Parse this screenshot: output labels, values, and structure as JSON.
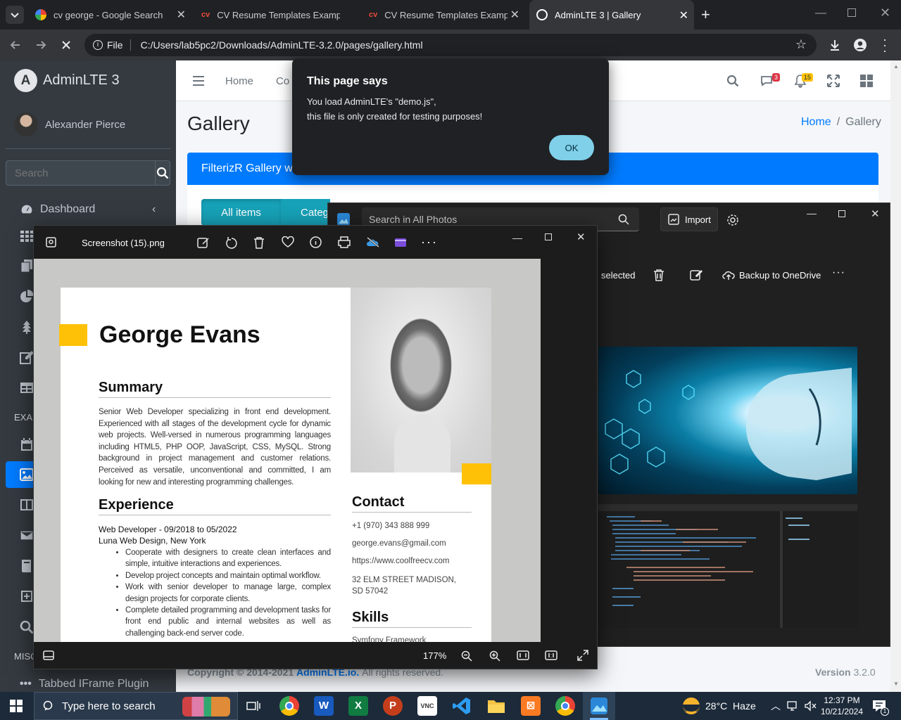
{
  "browser": {
    "tabs": [
      {
        "title": "cv george - Google Search",
        "icon": "google-icon"
      },
      {
        "title": "CV Resume Templates Examples",
        "icon": "cv-icon"
      },
      {
        "title": "CV Resume Templates Examples",
        "icon": "cv-icon"
      },
      {
        "title": "AdminLTE 3 | Gallery",
        "icon": "adminlte-icon",
        "active": true
      }
    ],
    "address_prefix": "File",
    "url": "C:/Users/lab5pc2/Downloads/AdminLTE-3.2.0/pages/gallery.html"
  },
  "sidebar": {
    "brand": "AdminLTE 3",
    "user": "Alexander Pierce",
    "search_placeholder": "Search",
    "dashboard": "Dashboard",
    "examples_header": "EXAM",
    "misc_header": "MISC",
    "bottom_item": "Tabbed IFrame Plugin"
  },
  "topnav": {
    "home": "Home",
    "contact": "Co",
    "messages_badge": "3",
    "notifications_badge": "15"
  },
  "page": {
    "title": "Gallery",
    "breadcrumb_home": "Home",
    "breadcrumb_sep": "/",
    "breadcrumb_current": "Gallery",
    "card_title": "FilterizR Gallery w",
    "filter_all": "All items",
    "filter_category": "Categ",
    "footer_copy": "Copyright © 2014-2021",
    "footer_brand": "AdminLTE.io.",
    "footer_rights": "All rights reserved.",
    "footer_version_label": "Version",
    "footer_version": "3.2.0"
  },
  "dialog": {
    "title": "This page says",
    "line1": "You load AdminLTE's \"demo.js\",",
    "line2": "this file is only created for testing purposes!",
    "ok": "OK"
  },
  "photos_app": {
    "search_placeholder": "Search in All Photos",
    "import": "Import",
    "selected": "selected",
    "backup": "Backup to OneDrive"
  },
  "viewer": {
    "filename": "Screenshot (15).png",
    "zoom": "177%"
  },
  "resume": {
    "name": "George Evans",
    "summary_heading": "Summary",
    "summary_text": "Senior Web Developer specializing in front end development. Experienced with all stages of the development cycle for dynamic web projects. Well-versed in numerous programming languages including HTML5, PHP OOP, JavaScript, CSS, MySQL. Strong background in project management and customer relations. Perceived as versatile, unconventional and committed, I am looking for new and interesting programming challenges.",
    "experience_heading": "Experience",
    "job_title": "Web Developer - 09/2018 to 05/2022",
    "company": "Luna Web Design, New York",
    "bullets": [
      "Cooperate with designers to create clean interfaces and simple, intuitive interactions and experiences.",
      "Develop project concepts and maintain optimal workflow.",
      "Work with senior developer to manage large, complex design projects for corporate clients.",
      "Complete detailed programming and development tasks for front end public and internal websites as well as challenging back-end server code."
    ],
    "contact_heading": "Contact",
    "phone": "+1 (970) 343 888 999",
    "email": "george.evans@gmail.com",
    "website": "https://www.coolfreecv.com",
    "address": "32 ELM STREET MADISON, SD 57042",
    "skills_heading": "Skills",
    "skills_partial": "Symfony Framework"
  },
  "taskbar": {
    "search_placeholder": "Type here to search",
    "weather": "28°C  Haze",
    "time": "12:37 PM",
    "date": "10/21/2024"
  },
  "colors": {
    "adminlte_primary": "#007bff",
    "adminlte_teal": "#17a2b8",
    "sidebar_bg": "#343a40",
    "dialog_button": "#7fd0e8",
    "resume_accent": "#ffc107"
  }
}
